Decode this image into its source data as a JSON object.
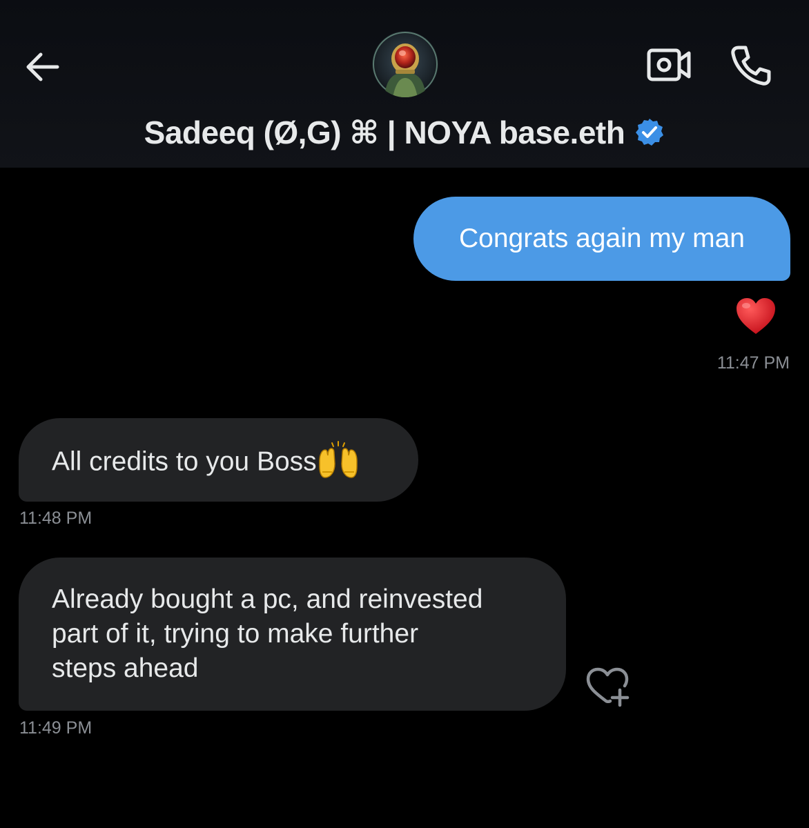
{
  "header": {
    "back_icon": "arrow-left-icon",
    "contact_name": "Sadeeq (Ø,G) ⌘ | NOYA base.eth",
    "verified_icon": "verified-badge-icon",
    "video_icon": "video-call-icon",
    "call_icon": "phone-icon"
  },
  "messages": [
    {
      "direction": "outgoing",
      "text": "Congrats again my man",
      "reaction": "❤️",
      "timestamp": "11:47 PM"
    },
    {
      "direction": "incoming",
      "text": "All credits to you Boss",
      "emoji": "🙌",
      "timestamp": "11:48 PM"
    },
    {
      "direction": "incoming",
      "lines": [
        "Already bought a pc, and reinvested",
        "part of it, trying to make further",
        "steps ahead"
      ],
      "timestamp": "11:49 PM"
    }
  ],
  "colors": {
    "background": "#000000",
    "outgoing_bubble": "#4c9ae6",
    "incoming_bubble": "#222325",
    "timestamp": "#8b8f95",
    "verified": "#3b8fe6"
  }
}
